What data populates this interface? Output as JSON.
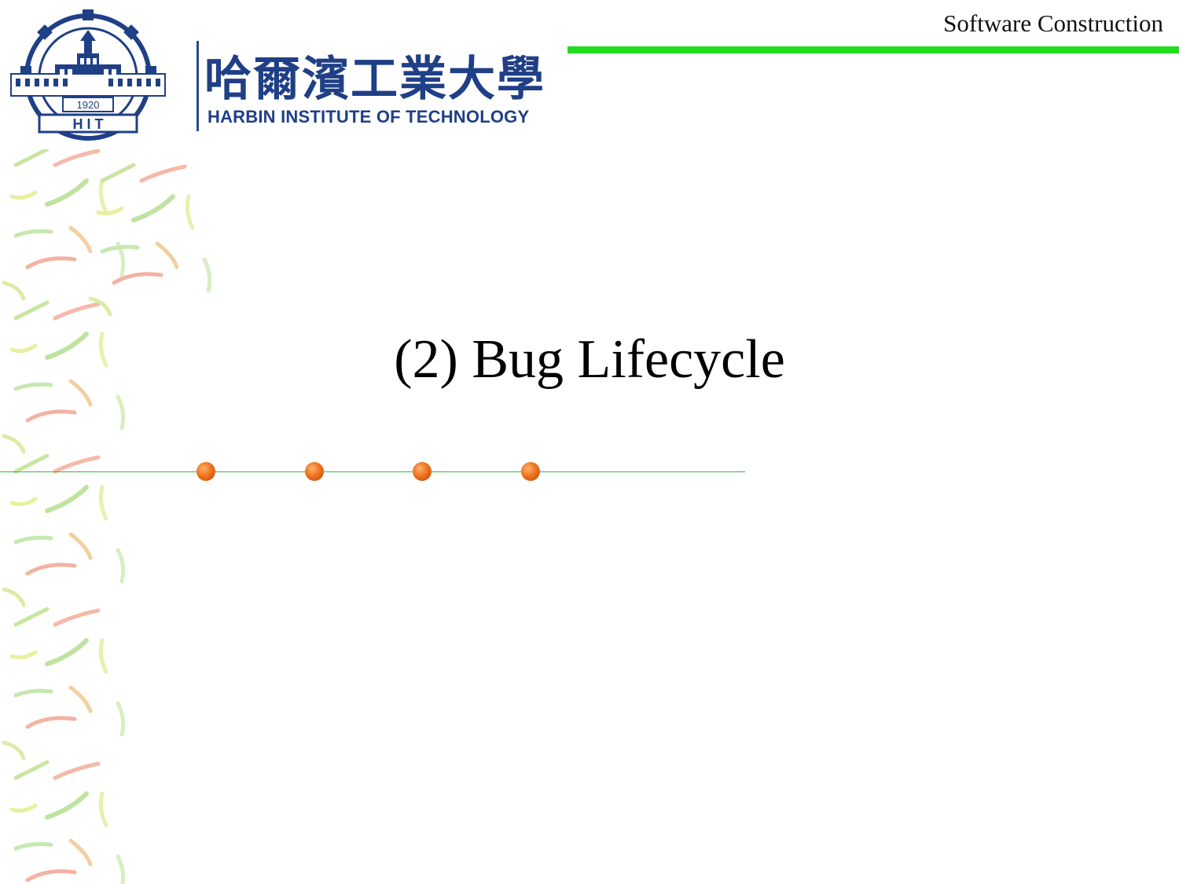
{
  "header": {
    "course_title": "Software Construction",
    "accent_color": "#22dd22"
  },
  "logo": {
    "emblem_year": "1920",
    "emblem_letters": "H I T",
    "name_cn": "哈爾濱工業大學",
    "name_en": "HARBIN INSTITUTE OF TECHNOLOGY",
    "brand_color": "#1f3f86"
  },
  "slide": {
    "title": "(2) Bug Lifecycle",
    "bullet_color": "#f0731c",
    "line_color": "#33bb33"
  }
}
